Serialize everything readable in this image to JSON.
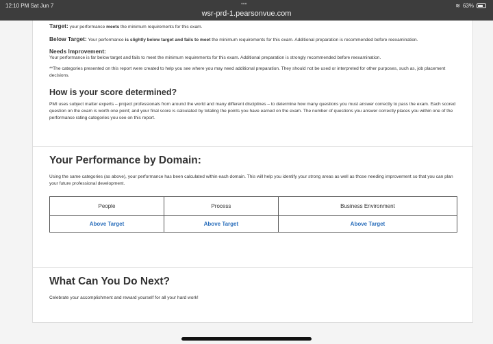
{
  "status_bar": {
    "time": "12:10 PM  Sat Jun 7",
    "dots": "•••",
    "url": "wsr-prd-1.pearsonvue.com",
    "battery": "63%"
  },
  "categories": {
    "target": {
      "label": "Target:",
      "pre": " your performance ",
      "bold": "meets",
      "post": " the minimum requirements for this exam."
    },
    "below": {
      "label": "Below Target:",
      "pre": " Your performance ",
      "bold": "is slightly below target and fails to meet",
      "post": " the minimum requirements for this exam. Additional preparation is recommended before reexamination."
    },
    "needs": {
      "label": "Needs Improvement:",
      "text": "Your performance is far below target and fails to meet the minimum requirements for this exam. Additional preparation is strongly recommended before reexamination."
    },
    "note": "**The categories presented on this report were created to help you see where you may need additional preparation. They should not be used or interpreted for other purposes, such as, job placement decisions."
  },
  "score": {
    "title": "How is your score determined?",
    "text": "PMI uses subject matter experts – project professionals from around the world and many different disciplines – to determine how many questions you must answer correctly to pass the exam. Each scored question on the exam is worth one point; and your final score is calculated by totaling the points you have earned on the exam. The number of questions you answer correctly places you within one of the performance rating categories you see on this report."
  },
  "domain": {
    "title": "Your Performance by Domain:",
    "text": "Using the same categories (as above), your performance has been calculated within each domain. This will help you identify your strong areas as well as those needing improvement so that you can plan your future professional development.",
    "columns": [
      "People",
      "Process",
      "Business Environment"
    ],
    "ratings": [
      "Above Target",
      "Above Target",
      "Above Target"
    ]
  },
  "next": {
    "title": "What Can You Do Next?",
    "text": "Celebrate your accomplishment and reward yourself for all your hard work!"
  }
}
